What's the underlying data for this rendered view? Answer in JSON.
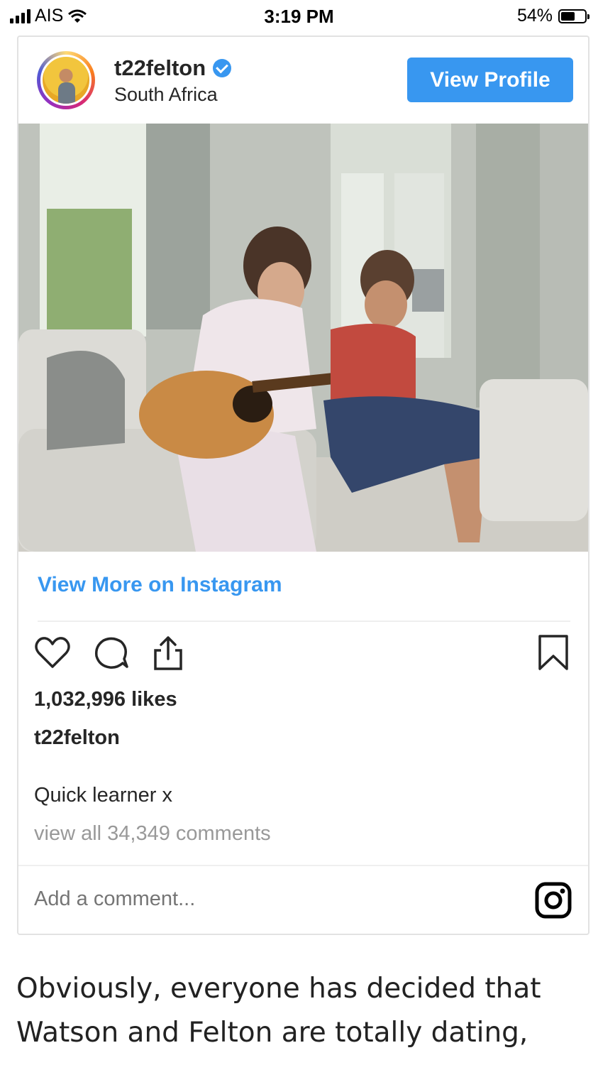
{
  "status_bar": {
    "carrier": "AIS",
    "time": "3:19 PM",
    "battery_percent": "54%",
    "battery_level": 0.54,
    "icons": [
      "signal-icon",
      "wifi-icon",
      "battery-icon"
    ]
  },
  "embed": {
    "username": "t22felton",
    "verified": true,
    "location": "South Africa",
    "view_profile_label": "View Profile",
    "view_more_label": "View More on Instagram",
    "action_icons": [
      "heart-icon",
      "comment-icon",
      "share-icon",
      "bookmark-icon"
    ],
    "likes": "1,032,996 likes",
    "caption_user": "t22felton",
    "caption_text": "Quick learner x",
    "view_comments": "view all 34,349 comments",
    "add_comment_placeholder": "Add a comment...",
    "accent_color": "#3897f0"
  },
  "article": {
    "text": "Obviously, everyone has decided that Watson and Felton are totally dating,"
  }
}
